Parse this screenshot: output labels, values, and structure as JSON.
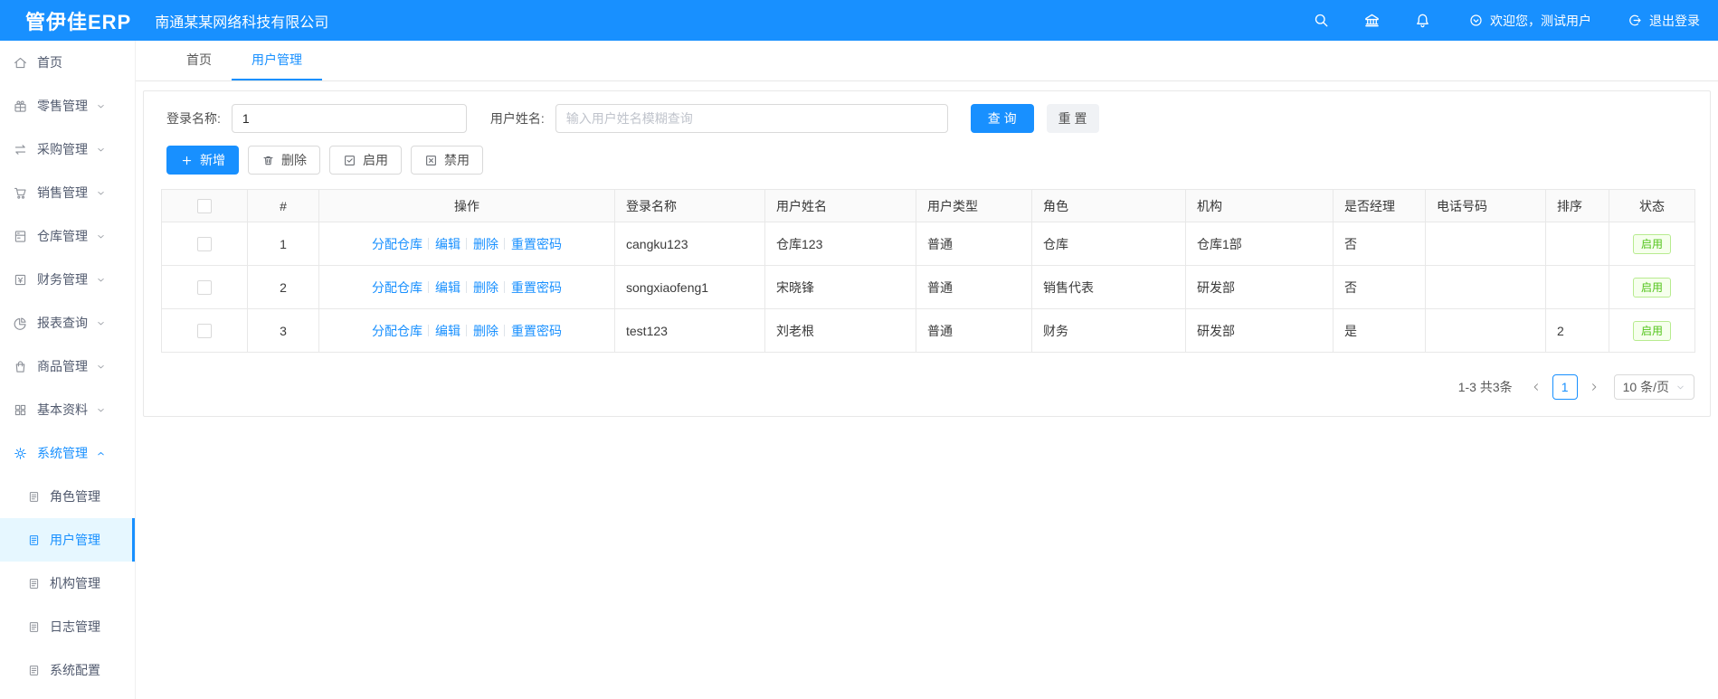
{
  "header": {
    "logo": "管伊佳ERP",
    "company": "南通某某网络科技有限公司",
    "welcome_text": "欢迎您，测试用户",
    "logout_text": "退出登录",
    "icons": [
      "search-icon",
      "bank-icon",
      "bell-icon"
    ]
  },
  "colors": {
    "primary": "#1890ff",
    "active_menu_bg": "#e6f7ff",
    "status_green": "#52c41a",
    "status_green_border": "#b7eb8f",
    "status_green_bg": "#f6ffed"
  },
  "sidebar": {
    "items": [
      {
        "label": "首页",
        "icon": "home-icon"
      },
      {
        "label": "零售管理",
        "icon": "retail-icon"
      },
      {
        "label": "采购管理",
        "icon": "purchase-icon"
      },
      {
        "label": "销售管理",
        "icon": "cart-icon"
      },
      {
        "label": "仓库管理",
        "icon": "warehouse-icon"
      },
      {
        "label": "财务管理",
        "icon": "finance-icon"
      },
      {
        "label": "报表查询",
        "icon": "report-icon"
      },
      {
        "label": "商品管理",
        "icon": "goods-icon"
      },
      {
        "label": "基本资料",
        "icon": "basic-data-icon"
      },
      {
        "label": "系统管理",
        "icon": "gear-icon",
        "expanded": true
      }
    ],
    "system_children": [
      {
        "label": "角色管理"
      },
      {
        "label": "用户管理",
        "active": true
      },
      {
        "label": "机构管理"
      },
      {
        "label": "日志管理"
      },
      {
        "label": "系统配置"
      }
    ]
  },
  "tabs": [
    {
      "label": "首页"
    },
    {
      "label": "用户管理",
      "active": true
    }
  ],
  "filters": {
    "login_name_label": "登录名称:",
    "login_name_value": "1",
    "user_name_label": "用户姓名:",
    "user_name_placeholder": "输入用户姓名模糊查询",
    "search_button": "查 询",
    "reset_button": "重 置"
  },
  "toolbar": {
    "add": "新增",
    "delete": "删除",
    "enable": "启用",
    "disable": "禁用"
  },
  "table": {
    "headers": [
      "#",
      "操作",
      "登录名称",
      "用户姓名",
      "用户类型",
      "角色",
      "机构",
      "是否经理",
      "电话号码",
      "排序",
      "状态"
    ],
    "action_links": [
      "分配仓库",
      "编辑",
      "删除",
      "重置密码"
    ],
    "rows": [
      {
        "idx": "1",
        "login": "cangku123",
        "name": "仓库123",
        "type": "普通",
        "role": "仓库",
        "org": "仓库1部",
        "manager": "否",
        "phone": "",
        "sort": "",
        "status": "启用"
      },
      {
        "idx": "2",
        "login": "songxiaofeng1",
        "name": "宋晓锋",
        "type": "普通",
        "role": "销售代表",
        "org": "研发部",
        "manager": "否",
        "phone": "",
        "sort": "",
        "status": "启用"
      },
      {
        "idx": "3",
        "login": "test123",
        "name": "刘老根",
        "type": "普通",
        "role": "财务",
        "org": "研发部",
        "manager": "是",
        "phone": "",
        "sort": "2",
        "status": "启用"
      }
    ]
  },
  "pagination": {
    "total_text": "1-3 共3条",
    "current_page": "1",
    "page_size": "10 条/页"
  }
}
